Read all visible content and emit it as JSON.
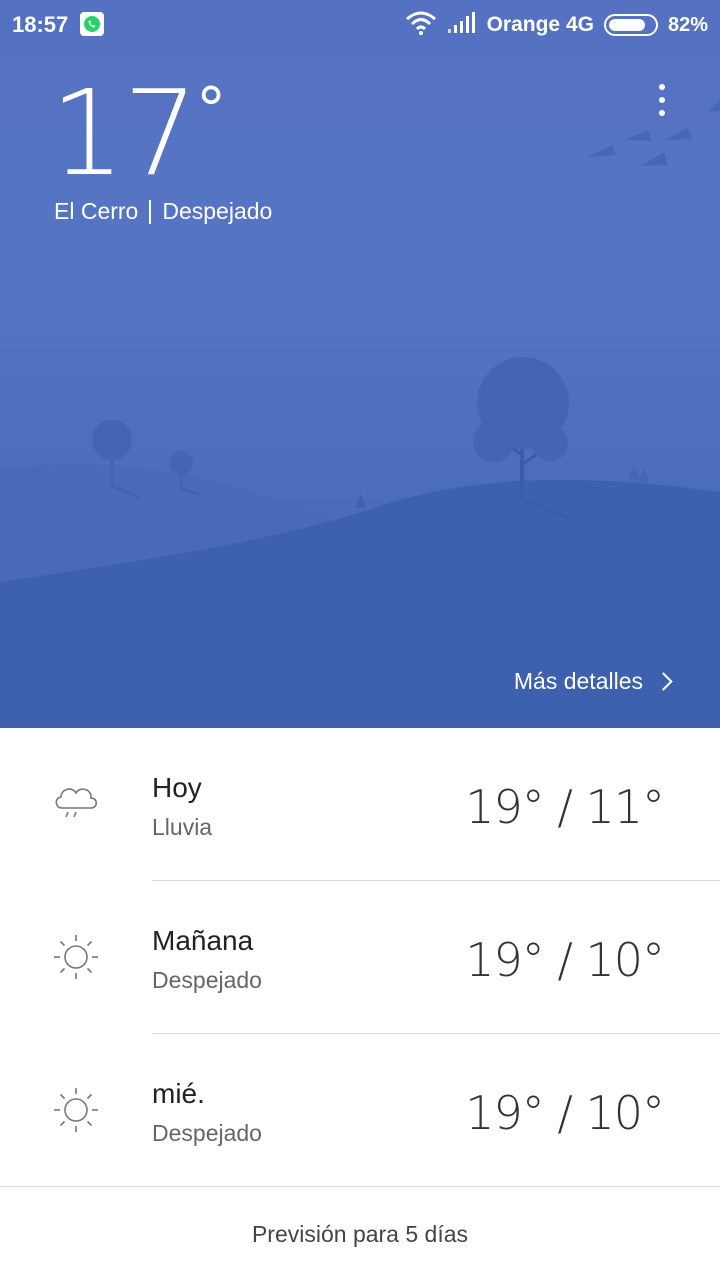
{
  "status_bar": {
    "time": "18:57",
    "carrier": "Orange 4G",
    "battery_percent": "82%",
    "battery_level": 0.82,
    "icons": [
      "whatsapp-icon",
      "wifi-icon",
      "signal-icon",
      "battery-icon"
    ]
  },
  "current": {
    "temperature": "17",
    "degree_symbol": "°",
    "location": "El Cerro",
    "condition": "Despejado"
  },
  "details_link": "Más detalles",
  "forecast": [
    {
      "day": "Hoy",
      "condition": "Lluvia",
      "temps": "19° / 11°",
      "icon": "rain-cloud-icon"
    },
    {
      "day": "Mañana",
      "condition": "Despejado",
      "temps": "19° / 10°",
      "icon": "sun-icon"
    },
    {
      "day": "mié.",
      "condition": "Despejado",
      "temps": "19° / 10°",
      "icon": "sun-icon"
    }
  ],
  "five_day_link": "Previsión para 5 días",
  "colors": {
    "sky_top": "#5572c2",
    "hill_back": "#4f6dbd",
    "hill_front": "#3a5fae",
    "tree": "#4564b5"
  }
}
